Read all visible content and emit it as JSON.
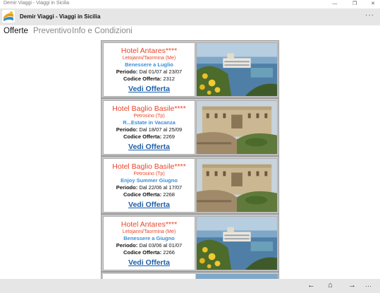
{
  "window": {
    "title": "Demir Viaggi - Viaggi in Sicilia",
    "minimize": "—",
    "restore": "❐",
    "close": "✕"
  },
  "app": {
    "title": "Demir Viaggi - Viaggi in Sicilia",
    "more": "···"
  },
  "tabs": [
    {
      "label": "Offerte"
    },
    {
      "label": "Preventivo"
    },
    {
      "label": "Info e Condizioni"
    }
  ],
  "offers": [
    {
      "hotel": "Hotel Antares****",
      "location": "Letojanni/Taormina (Me)",
      "offer": "Benessere a Luglio",
      "period_label": "Periodo:",
      "period": "Dal 01/07 al 23/07",
      "code_label": "Codice Offerta:",
      "code": "2312",
      "link": "Vedi Offerta",
      "photo": "seaside-hotel"
    },
    {
      "hotel": "Hotel Baglio Basile****",
      "location": "Petrosino (Tp)",
      "offer": "R...Estate in Vacanza",
      "period_label": "Periodo:",
      "period": "Dal 18/07 al 25/09",
      "code_label": "Codice Offerta:",
      "code": "2269",
      "link": "Vedi Offerta",
      "photo": "baglio-courtyard"
    },
    {
      "hotel": "Hotel Baglio Basile****",
      "location": "Petrosino (Tp)",
      "offer": "Enjoy Summer Giugno",
      "period_label": "Periodo:",
      "period": "Dal 22/06 al 17/07",
      "code_label": "Codice Offerta:",
      "code": "2268",
      "link": "Vedi Offerta",
      "photo": "baglio-courtyard"
    },
    {
      "hotel": "Hotel Antares****",
      "location": "Letojanni/Taormina (Me)",
      "offer": "Benessere a Giugno",
      "period_label": "Periodo:",
      "period": "Dal 03/06 al 01/07",
      "code_label": "Codice Offerta:",
      "code": "2266",
      "link": "Vedi Offerta",
      "photo": "seaside-hotel"
    }
  ],
  "bottombar": {
    "back": "←",
    "home": "⌂",
    "forward": "→",
    "more": "···"
  },
  "colors": {
    "hotel_name": "#e8452a",
    "offer_name": "#3a8fd8",
    "link": "#1d5ea8",
    "appbar": "#e6e6e6"
  }
}
